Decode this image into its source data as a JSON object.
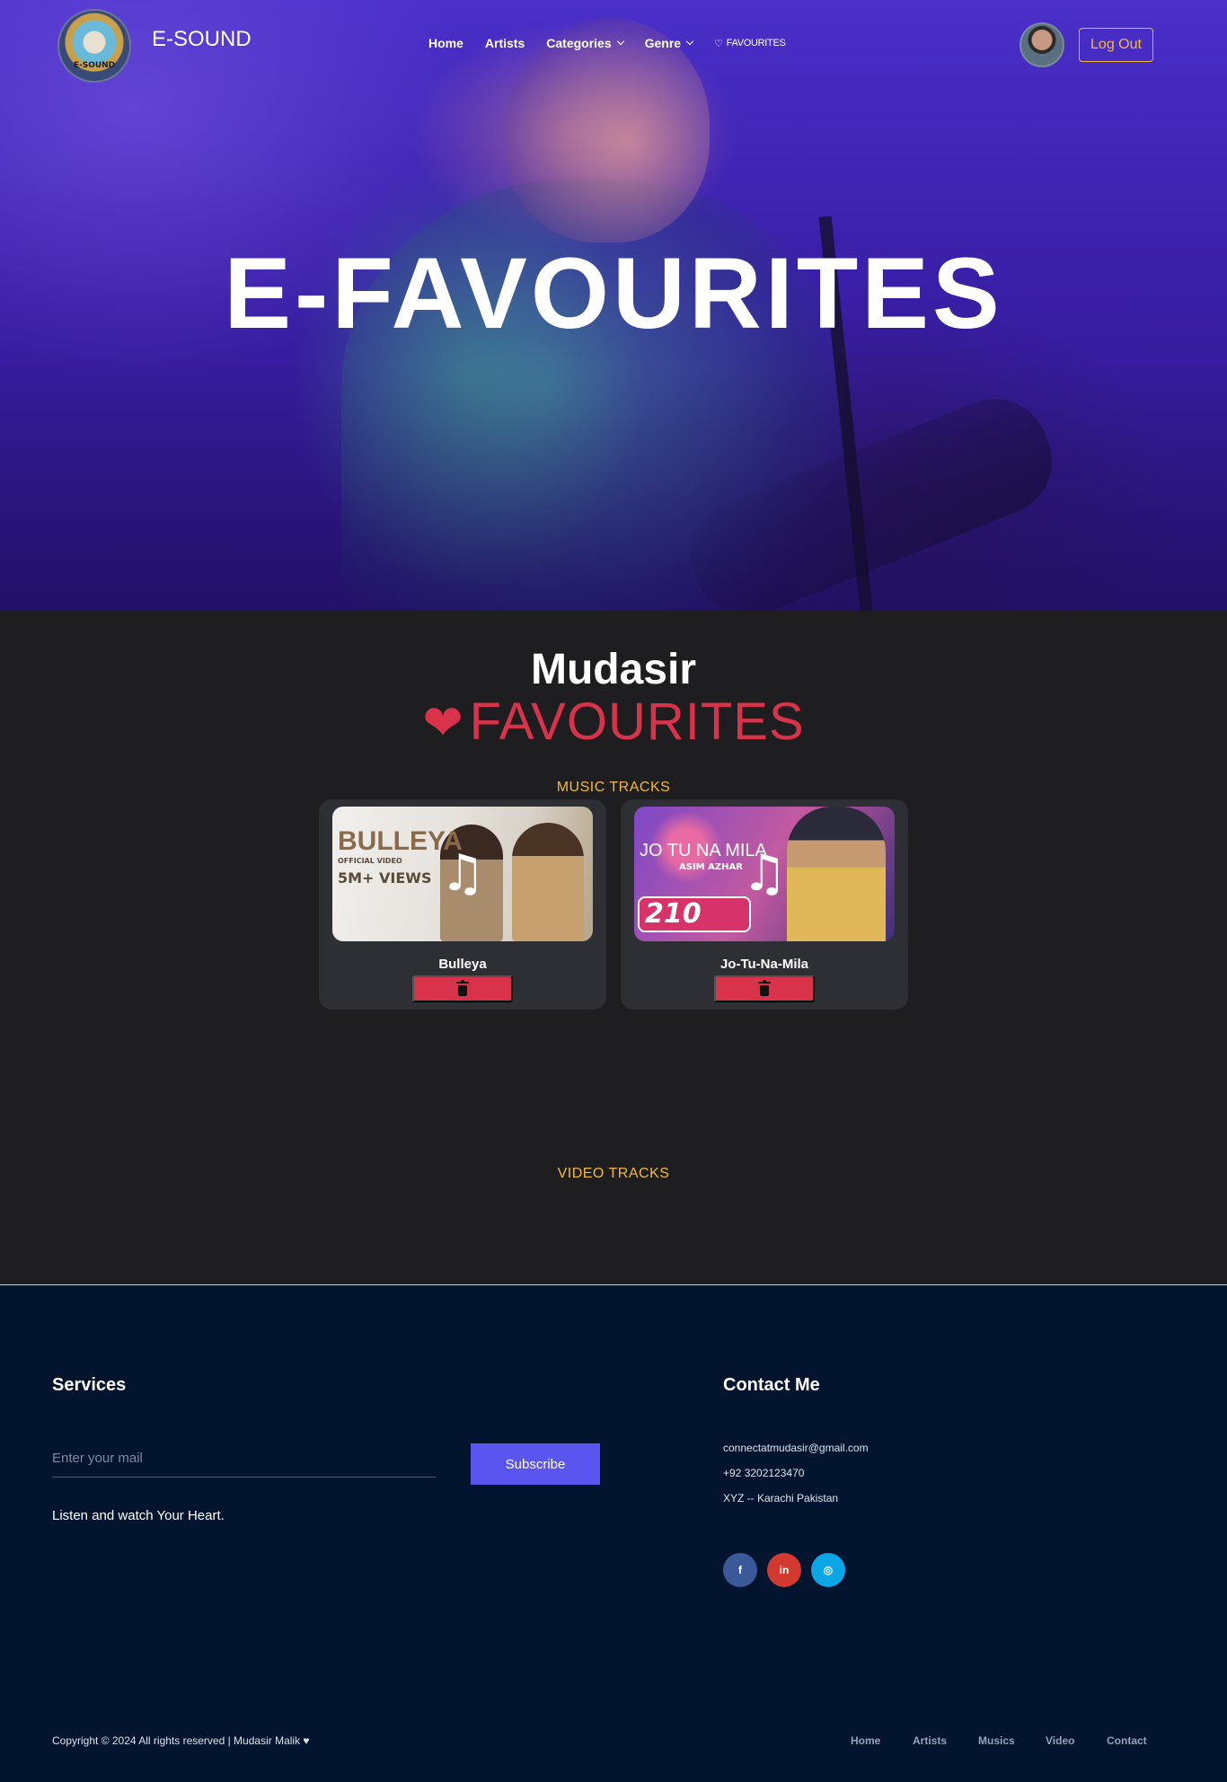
{
  "header": {
    "logo_text": "E-SOUND",
    "brand": "E-SOUND",
    "nav": [
      {
        "label": "Home"
      },
      {
        "label": "Artists"
      },
      {
        "label": "Categories"
      },
      {
        "label": "Genre"
      },
      {
        "label": "FAVOURITES"
      }
    ],
    "logout_label": "Log Out"
  },
  "hero": {
    "title": "E-FAVOURITES"
  },
  "favourites": {
    "user_name": "Mudasir",
    "heading": "FAVOURITES",
    "music_section_label": "MUSIC TRACKS",
    "video_section_label": "VIDEO TRACKS",
    "tracks": [
      {
        "name": "Bulleya",
        "thumb_title": "BULLEYA",
        "thumb_subtitle": "OFFICIAL VIDEO",
        "thumb_views": "5M+ VIEWS"
      },
      {
        "name": "Jo-Tu-Na-Mila",
        "thumb_title": "JO TU NA MILA",
        "thumb_subtitle": "ASIM AZHAR",
        "thumb_views": "210"
      }
    ]
  },
  "footer": {
    "services_heading": "Services",
    "email_placeholder": "Enter your mail",
    "subscribe_label": "Subscribe",
    "tagline": "Listen and watch Your Heart.",
    "contact_heading": "Contact Me",
    "email": "connectatmudasir@gmail.com",
    "phone": "+92 3202123470",
    "address": "XYZ -- Karachi Pakistan",
    "social": [
      {
        "icon": "facebook-icon",
        "glyph": "f",
        "color": "#3b5998"
      },
      {
        "icon": "linkedin-icon",
        "glyph": "in",
        "color": "#d33a2f"
      },
      {
        "icon": "instagram-icon",
        "glyph": "◎",
        "color": "#0aa6e6"
      }
    ],
    "copyright": "Copyright © 2024 All rights reserved | Mudasir Malik",
    "links": [
      "Home",
      "Artists",
      "Musics",
      "Video",
      "Contact"
    ]
  },
  "colors": {
    "accent_gold": "#f3b93a",
    "fav_red": "#d8334a",
    "subscribe_blue": "#5b55f0",
    "footer_bg": "#02142e",
    "page_bg": "#1e1e20"
  }
}
